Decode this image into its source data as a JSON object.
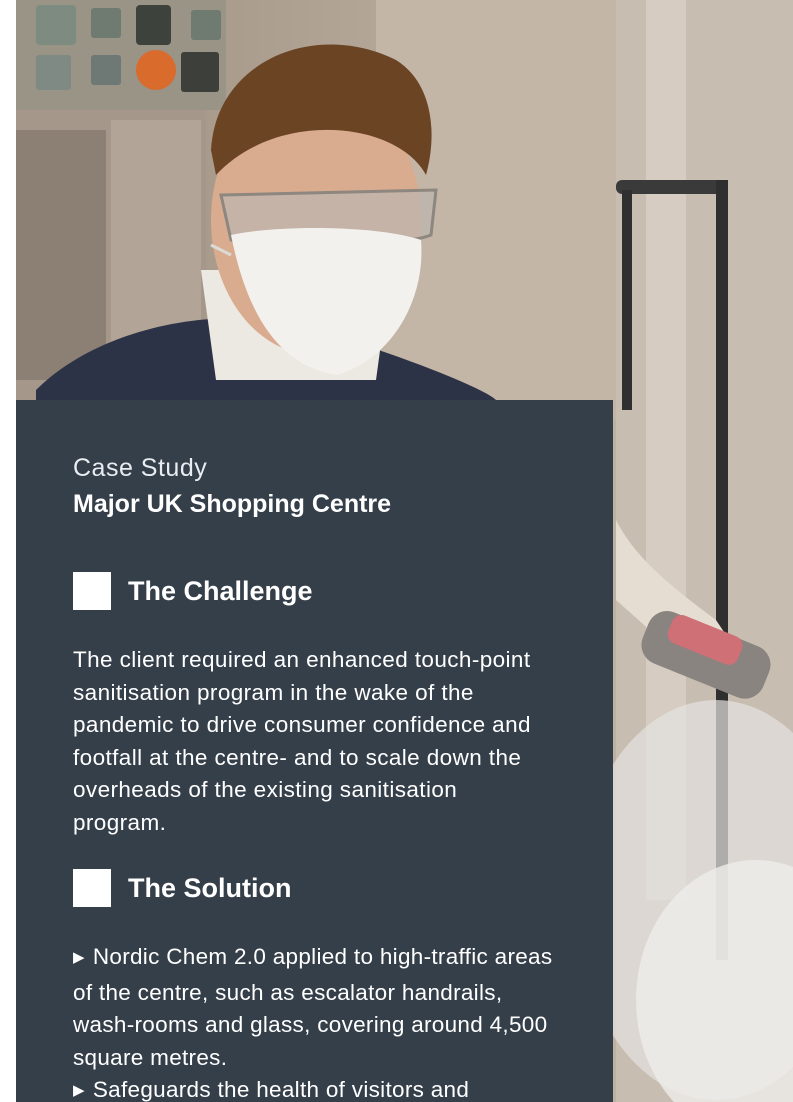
{
  "hero": {
    "alt": "Technician wearing safety glasses and face mask applying sanitiser spray"
  },
  "card": {
    "eyebrow": "Case Study",
    "title": "Major UK Shopping Centre",
    "challenge": {
      "heading": "The Challenge",
      "body": "The client required an enhanced touch-point sanitisation program in the wake of the pandemic to drive consumer confidence and footfall at the centre- and to scale down the overheads of the existing sanitisation program."
    },
    "solution": {
      "heading": "The Solution",
      "bullets": [
        "Nordic Chem 2.0 applied to high-traffic areas of the centre, such as escalator handrails, wash-rooms and glass, covering around 4,500 square metres.",
        "Safeguards the health of visitors and"
      ],
      "bullet_marker": "▶"
    }
  },
  "colors": {
    "card_background": "#353f4a",
    "text": "#ffffff"
  }
}
